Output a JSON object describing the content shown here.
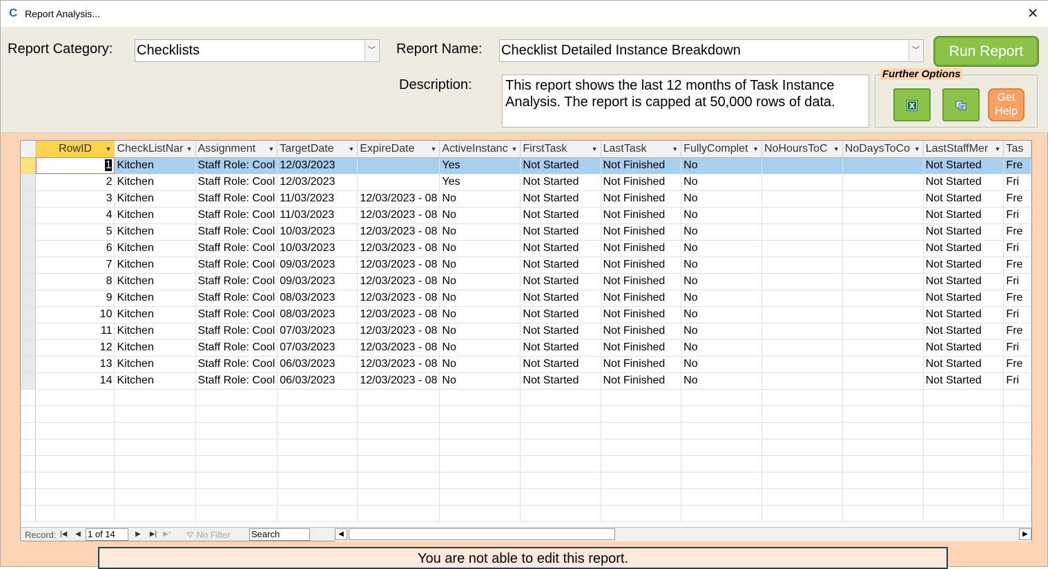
{
  "window": {
    "title": "Report Analysis..."
  },
  "form": {
    "category_label": "Report Category:",
    "category_value": "Checklists",
    "name_label": "Report Name:",
    "name_value": "Checklist Detailed Instance Breakdown",
    "run_label": "Run Report",
    "description_label": "Description:",
    "description_text": "This report shows the last 12 months of Task Instance Analysis.  The report is capped at 50,000 rows of data.",
    "options_label": "Further Options",
    "help_label_1": "Get",
    "help_label_2": "Help"
  },
  "grid": {
    "columns": [
      "RowID",
      "CheckListNar",
      "Assignment",
      "TargetDate",
      "ExpireDate",
      "ActiveInstanc",
      "FirstTask",
      "LastTask",
      "FullyComplet",
      "NoHoursToC",
      "NoDaysToCo",
      "LastStaffMer",
      "Tas"
    ],
    "rows": [
      [
        "1",
        "Kitchen",
        "Staff Role: Cool",
        "12/03/2023",
        "",
        "Yes",
        "Not Started",
        "Not Finished",
        "No",
        "",
        "",
        "Not Started",
        "Fre"
      ],
      [
        "2",
        "Kitchen",
        "Staff Role: Cool",
        "12/03/2023",
        "",
        "Yes",
        "Not Started",
        "Not Finished",
        "No",
        "",
        "",
        "Not Started",
        "Fri"
      ],
      [
        "3",
        "Kitchen",
        "Staff Role: Cool",
        "11/03/2023",
        "12/03/2023 - 08",
        "No",
        "Not Started",
        "Not Finished",
        "No",
        "",
        "",
        "Not Started",
        "Fre"
      ],
      [
        "4",
        "Kitchen",
        "Staff Role: Cool",
        "11/03/2023",
        "12/03/2023 - 08",
        "No",
        "Not Started",
        "Not Finished",
        "No",
        "",
        "",
        "Not Started",
        "Fri"
      ],
      [
        "5",
        "Kitchen",
        "Staff Role: Cool",
        "10/03/2023",
        "12/03/2023 - 08",
        "No",
        "Not Started",
        "Not Finished",
        "No",
        "",
        "",
        "Not Started",
        "Fre"
      ],
      [
        "6",
        "Kitchen",
        "Staff Role: Cool",
        "10/03/2023",
        "12/03/2023 - 08",
        "No",
        "Not Started",
        "Not Finished",
        "No",
        "",
        "",
        "Not Started",
        "Fri"
      ],
      [
        "7",
        "Kitchen",
        "Staff Role: Cool",
        "09/03/2023",
        "12/03/2023 - 08",
        "No",
        "Not Started",
        "Not Finished",
        "No",
        "",
        "",
        "Not Started",
        "Fre"
      ],
      [
        "8",
        "Kitchen",
        "Staff Role: Cool",
        "09/03/2023",
        "12/03/2023 - 08",
        "No",
        "Not Started",
        "Not Finished",
        "No",
        "",
        "",
        "Not Started",
        "Fri"
      ],
      [
        "9",
        "Kitchen",
        "Staff Role: Cool",
        "08/03/2023",
        "12/03/2023 - 08",
        "No",
        "Not Started",
        "Not Finished",
        "No",
        "",
        "",
        "Not Started",
        "Fre"
      ],
      [
        "10",
        "Kitchen",
        "Staff Role: Cool",
        "08/03/2023",
        "12/03/2023 - 08",
        "No",
        "Not Started",
        "Not Finished",
        "No",
        "",
        "",
        "Not Started",
        "Fri"
      ],
      [
        "11",
        "Kitchen",
        "Staff Role: Cool",
        "07/03/2023",
        "12/03/2023 - 08",
        "No",
        "Not Started",
        "Not Finished",
        "No",
        "",
        "",
        "Not Started",
        "Fre"
      ],
      [
        "12",
        "Kitchen",
        "Staff Role: Cool",
        "07/03/2023",
        "12/03/2023 - 08",
        "No",
        "Not Started",
        "Not Finished",
        "No",
        "",
        "",
        "Not Started",
        "Fri"
      ],
      [
        "13",
        "Kitchen",
        "Staff Role: Cool",
        "06/03/2023",
        "12/03/2023 - 08",
        "No",
        "Not Started",
        "Not Finished",
        "No",
        "",
        "",
        "Not Started",
        "Fre"
      ],
      [
        "14",
        "Kitchen",
        "Staff Role: Cool",
        "06/03/2023",
        "12/03/2023 - 08",
        "No",
        "Not Started",
        "Not Finished",
        "No",
        "",
        "",
        "Not Started",
        "Fri"
      ]
    ]
  },
  "navigation": {
    "record_label": "Record:",
    "record_position": "1 of 14",
    "filter_label": "No Filter",
    "search_label": "Search"
  },
  "notice": "You are not able to edit this report.",
  "colors": {
    "accent_green": "#8bc34a",
    "help_orange": "#f4a262",
    "selected_row": "#a8cff0",
    "header_highlight": "#ffd24d",
    "background": "#fcd5b4"
  }
}
